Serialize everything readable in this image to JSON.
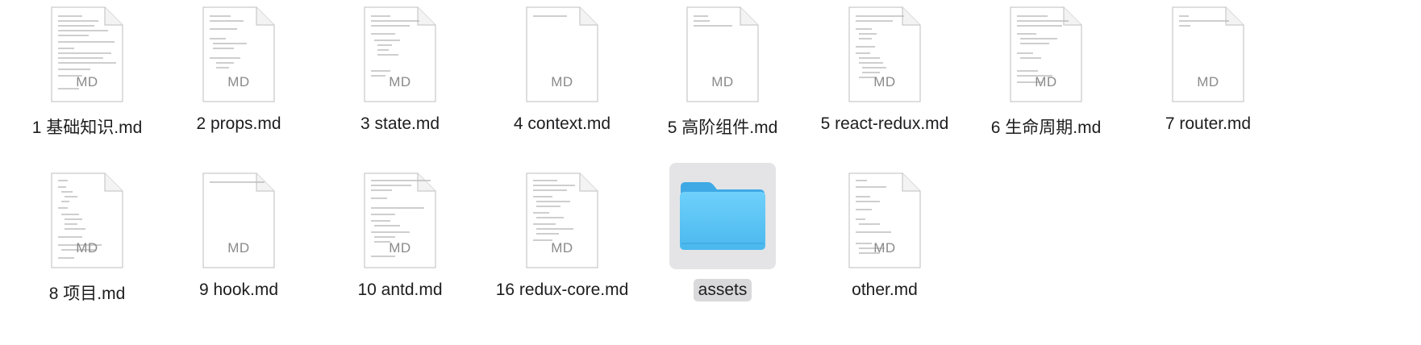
{
  "window": {
    "title": ""
  },
  "icons": {
    "document": "markdown-document-icon",
    "folder": "folder-icon"
  },
  "colors": {
    "folder": "#5ac8fa",
    "selection": "#e4e4e6",
    "label_selection": "#d9d9dc"
  },
  "files": [
    {
      "name": "1 基础知识.md",
      "type": "document",
      "badge": "MD",
      "selected": false
    },
    {
      "name": "2 props.md",
      "type": "document",
      "badge": "MD",
      "selected": false
    },
    {
      "name": "3 state.md",
      "type": "document",
      "badge": "MD",
      "selected": false
    },
    {
      "name": "4 context.md",
      "type": "document",
      "badge": "MD",
      "selected": false
    },
    {
      "name": "5 高阶组件.md",
      "type": "document",
      "badge": "MD",
      "selected": false
    },
    {
      "name": "5 react-redux.md",
      "type": "document",
      "badge": "MD",
      "selected": false
    },
    {
      "name": "6 生命周期.md",
      "type": "document",
      "badge": "MD",
      "selected": false
    },
    {
      "name": "7 router.md",
      "type": "document",
      "badge": "MD",
      "selected": false
    },
    {
      "name": "8 项目.md",
      "type": "document",
      "badge": "MD",
      "selected": false
    },
    {
      "name": "9 hook.md",
      "type": "document",
      "badge": "MD",
      "selected": false
    },
    {
      "name": "10 antd.md",
      "type": "document",
      "badge": "MD",
      "selected": false
    },
    {
      "name": "16 redux-core.md",
      "type": "document",
      "badge": "MD",
      "selected": false
    },
    {
      "name": "assets",
      "type": "folder",
      "badge": "",
      "selected": true
    },
    {
      "name": "other.md",
      "type": "document",
      "badge": "MD",
      "selected": false
    }
  ]
}
